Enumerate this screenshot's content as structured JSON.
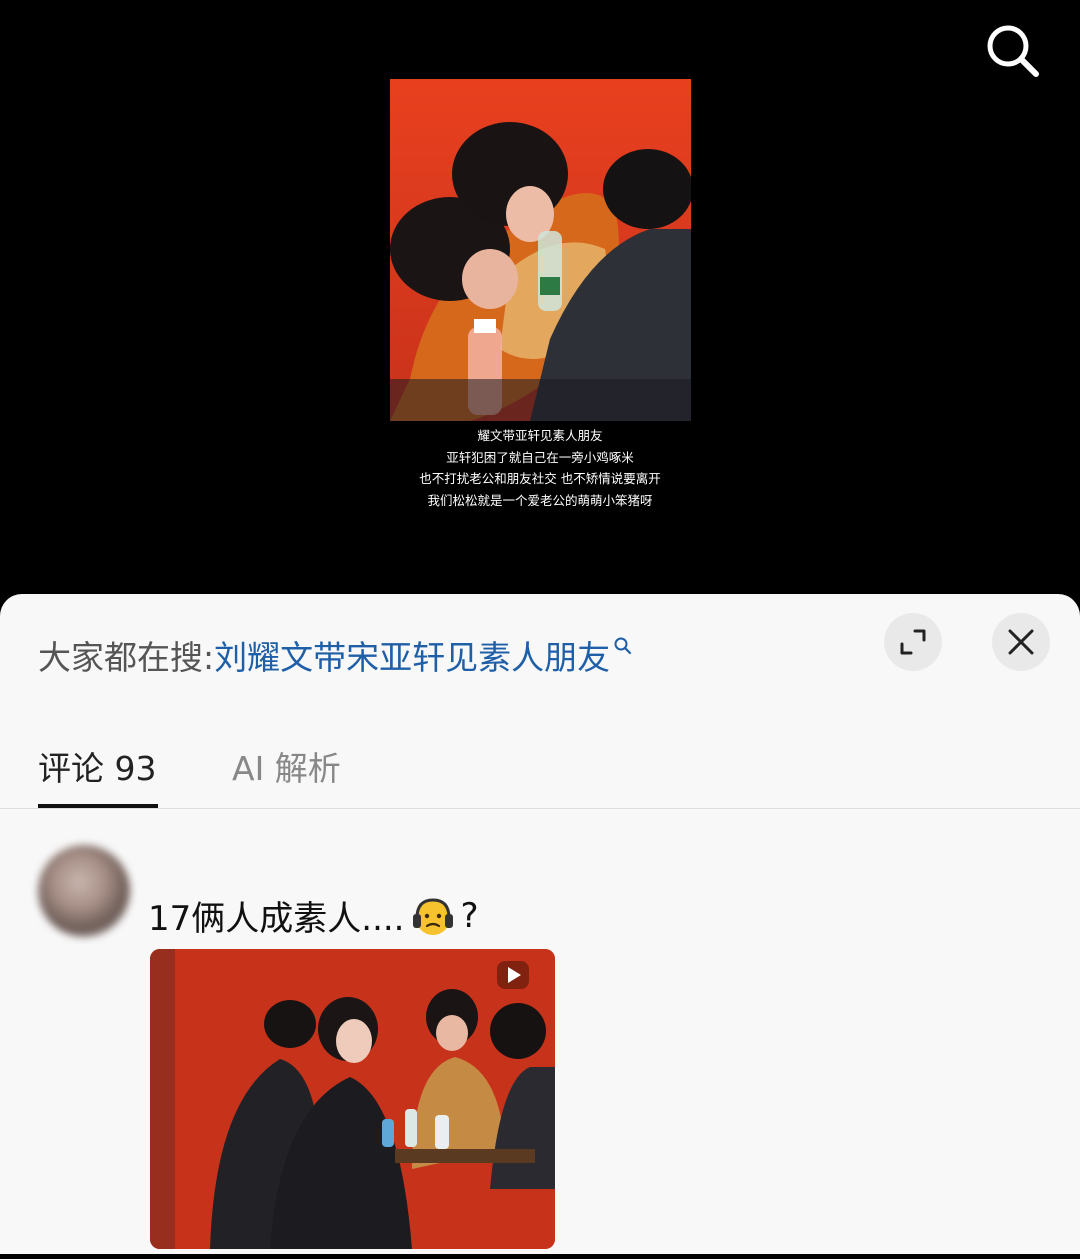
{
  "video": {
    "caption_lines": [
      "耀文带亚轩见素人朋友",
      "亚轩犯困了就自己在一旁小鸡啄米",
      "也不打扰老公和朋友社交 也不矫情说要离开",
      "我们松松就是一个爱老公的萌萌小笨猪呀"
    ],
    "search_icon": "search-icon"
  },
  "sheet": {
    "hot_search_prefix": "大家都在搜:",
    "hot_search_term": "刘耀文带宋亚轩见素人朋友",
    "expand_icon": "expand-icon",
    "close_icon": "close-icon"
  },
  "tabs": [
    {
      "label": "评论 93",
      "active": true
    },
    {
      "label": "AI 解析",
      "active": false
    }
  ],
  "comment": {
    "text_before_emoji": "17俩人成素人....",
    "emoji": "headphones-face-emoji",
    "text_after_emoji": "?",
    "media_icon": "play-icon"
  },
  "colors": {
    "background_top": "#000000",
    "sheet_background": "#f8f8f8",
    "hot_search_link": "#1f5fa8",
    "tab_active": "#222222",
    "tab_inactive": "#888888"
  }
}
